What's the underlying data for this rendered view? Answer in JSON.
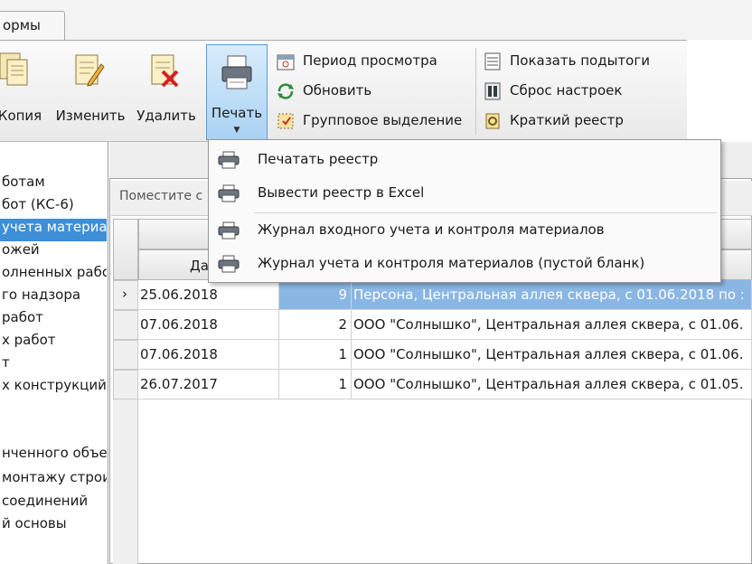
{
  "tabs": [
    {
      "label": "ормы"
    }
  ],
  "ribbon": {
    "buttons": [
      {
        "id": "copy",
        "label": "Копия",
        "icon": "copy-document-icon"
      },
      {
        "id": "edit",
        "label": "Изменить",
        "icon": "edit-document-icon"
      },
      {
        "id": "delete",
        "label": "Удалить",
        "icon": "delete-document-icon"
      },
      {
        "id": "print",
        "label": "Печать",
        "icon": "printer-icon"
      }
    ],
    "group1": [
      {
        "label": "Период просмотра",
        "icon": "calendar-icon"
      },
      {
        "label": "Обновить",
        "icon": "refresh-icon"
      },
      {
        "label": "Групповое выделение",
        "icon": "group-select-icon"
      }
    ],
    "group2": [
      {
        "label": "Показать подытоги",
        "icon": "subtotals-icon"
      },
      {
        "label": "Сброс настроек",
        "icon": "reset-settings-icon"
      },
      {
        "label": "Краткий реестр",
        "icon": "short-register-icon"
      }
    ]
  },
  "print_menu": [
    {
      "label": "Печатать реестр",
      "icon": "printer-icon"
    },
    {
      "label": "Вывести реестр в Excel",
      "icon": "printer-icon"
    },
    {
      "label": "Журнал входного учета и контроля материалов",
      "icon": "printer-icon"
    },
    {
      "label": "Журнал учета и контроля материалов  (пустой бланк)",
      "icon": "printer-icon"
    }
  ],
  "nav": [
    {
      "label": "ботам"
    },
    {
      "label": "бот (КС-6)"
    },
    {
      "label": "учета материа",
      "selected": true
    },
    {
      "label": "ожей"
    },
    {
      "label": "олненных рабо"
    },
    {
      "label": "го надзора"
    },
    {
      "label": "работ"
    },
    {
      "label": "х работ"
    },
    {
      "label": "т"
    },
    {
      "label": "х конструкций"
    },
    {
      "label": ""
    },
    {
      "label": ""
    },
    {
      "label": "нченного объе"
    },
    {
      "label": "монтажу строи"
    },
    {
      "label": "соединений"
    },
    {
      "label": "й основы"
    }
  ],
  "filter": {
    "text": "Поместите с"
  },
  "table": {
    "date_header": "Да",
    "rows": [
      {
        "date": "25.06.2018",
        "num": "9",
        "desc": "Персона, Центральная аллея сквера, с 01.06.2018 по :",
        "selected": true
      },
      {
        "date": "07.06.2018",
        "num": "2",
        "desc": "ООО \"Солнышко\", Центральная аллея сквера, с 01.06."
      },
      {
        "date": "07.06.2018",
        "num": "1",
        "desc": "ООО \"Солнышко\", Центральная аллея сквера, с 01.06."
      },
      {
        "date": "26.07.2017",
        "num": "1",
        "desc": "ООО \"Солнышко\", Центральная аллея сквера, с 01.05."
      }
    ],
    "row_marker": "›"
  },
  "colors": {
    "accent": "#3d8fd7",
    "selection": "#8ab6e4",
    "print_button": "#a9d2f3"
  }
}
